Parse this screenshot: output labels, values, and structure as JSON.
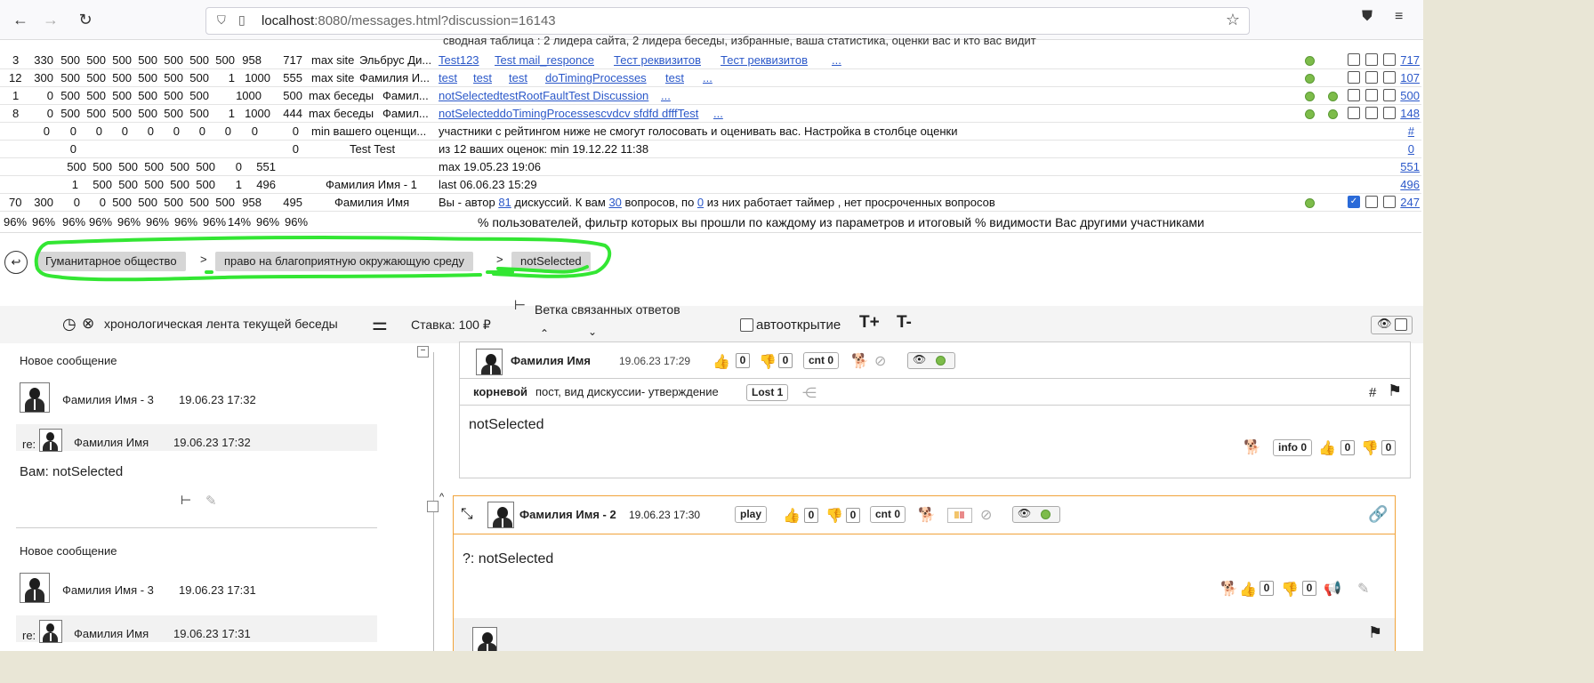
{
  "browser": {
    "url_host": "localhost",
    "url_rest": ":8080/messages.html?discussion=16143"
  },
  "stats": {
    "caption": "сводная таблица : 2 лидера сайта, 2 лидера беседы, избранные, ваша статистика, оценки вас и кто вас видит",
    "rows": {
      "r0": {
        "id": "3",
        "n": [
          "330",
          "500",
          "500",
          "500",
          "500",
          "500",
          "500",
          "500",
          "958",
          "717"
        ],
        "label": "max site",
        "name": "Эльбрус Ди...",
        "links": [
          "Test123",
          "Test mail_responce",
          "Тест реквизитов",
          "Тест реквизитов",
          "..."
        ],
        "rnum": "717"
      },
      "r1": {
        "id": "12",
        "n": [
          "300",
          "500",
          "500",
          "500",
          "500",
          "500",
          "500",
          "1",
          "1000",
          "555"
        ],
        "label": "max site",
        "name": "Фамилия И...",
        "links": [
          "test",
          "test",
          "test",
          "doTimingProcesses",
          "test",
          "..."
        ],
        "rnum": "107"
      },
      "r2": {
        "id": "1",
        "n": [
          "0",
          "500",
          "500",
          "500",
          "500",
          "500",
          "500",
          "1000",
          "500"
        ],
        "label": "max беседы",
        "name": "Фамил...",
        "links": [
          "notSelectedtestRootFaultTest Discussion",
          "..."
        ],
        "rnum": "500"
      },
      "r3": {
        "id": "8",
        "n": [
          "0",
          "500",
          "500",
          "500",
          "500",
          "500",
          "500",
          "1",
          "1000",
          "444"
        ],
        "label": "max беседы",
        "name": "Фамил...",
        "links": [
          "notSelecteddoTimingProcessescvdcv sfdfd dfffTest",
          "..."
        ],
        "rnum": "148"
      },
      "r4": {
        "n": [
          "0",
          "0",
          "0",
          "0",
          "0",
          "0",
          "0",
          "0",
          "0",
          "0"
        ],
        "label": "min вашего оценщи...",
        "text": "участники с рейтингом ниже не смогут голосовать и оценивать вас. Настройка в столбце оценки",
        "rnum": "#"
      },
      "r5": {
        "a": "0",
        "b": "0",
        "name": "Test Test",
        "text": "из 12 ваших оценок: min 19.12.22 11:38",
        "rnum": "0"
      },
      "r6": {
        "n": [
          "500",
          "500",
          "500",
          "500",
          "500",
          "500",
          "0",
          "551"
        ],
        "text": "max 19.05.23 19:06",
        "rnum": "551"
      },
      "r7": {
        "n": [
          "1",
          "500",
          "500",
          "500",
          "500",
          "500",
          "1",
          "496"
        ],
        "name": "Фамилия Имя - 1",
        "text": "last 06.06.23 15:29",
        "rnum": "496"
      },
      "r8": {
        "id": "70",
        "n": [
          "300",
          "0",
          "0",
          "500",
          "500",
          "500",
          "500",
          "500",
          "958",
          "495"
        ],
        "name": "Фамилия Имя",
        "text_a": "Вы - автор",
        "link_a": "81",
        "text_b": "дискуссий. К вам",
        "link_b": "30",
        "text_c": "вопросов, по",
        "link_c": "0",
        "text_d": "из них работает таймер , нет просроченных вопросов",
        "rnum": "247"
      },
      "r9": {
        "p": [
          "96%",
          "96%",
          "96%",
          "96%",
          "96%",
          "96%",
          "96%",
          "96%",
          "14%",
          "96%",
          "96%"
        ],
        "text": "% пользователей, фильтр которых вы прошли по каждому из параметров и итоговый % видимости Вас другими участниками"
      }
    }
  },
  "breadcrumb": {
    "items": [
      "Гуманитарное общество",
      "право на благоприятную окружающую среду",
      "notSelected"
    ],
    "sep": ">"
  },
  "header": {
    "feed_label": "хронологическая лента текущей беседы",
    "stake": "Ставка: 100 ₽",
    "branch": "Ветка связанных ответов",
    "autoopen": "автооткрытие",
    "font_plus": "T+",
    "font_minus": "T-"
  },
  "feed": [
    {
      "title": "Новое сообщение",
      "author": "Фамилия Имя - 3",
      "time": "19.06.23 17:32",
      "re_label": "re:",
      "re_author": "Фамилия Имя",
      "re_time": "19.06.23 17:32",
      "text": "Вам: notSelected"
    },
    {
      "title": "Новое сообщение",
      "author": "Фамилия Имя - 3",
      "time": "19.06.23 17:31",
      "re_label": "re:",
      "re_author": "Фамилия Имя",
      "re_time": "19.06.23 17:31"
    }
  ],
  "post1": {
    "author": "Фамилия Имя",
    "time": "19.06.23 17:29",
    "likes": "0",
    "dislikes": "0",
    "cnt": "cnt 0",
    "root_bold": "корневой",
    "root_rest": "пост, вид дискуссии- утверждение",
    "lost": "Lost 1",
    "hash": "#",
    "body": "notSelected",
    "info": "info 0",
    "likes2": "0",
    "dislikes2": "0"
  },
  "post2": {
    "author": "Фамилия Имя - 2",
    "time": "19.06.23 17:30",
    "play": "play",
    "likes": "0",
    "dislikes": "0",
    "cnt": "cnt 0",
    "body": "?: notSelected",
    "likes2": "0",
    "dislikes2": "0"
  },
  "colors": {
    "highlight": "#33e633",
    "accent_border": "#f1a33a",
    "link": "#2b58c9"
  }
}
